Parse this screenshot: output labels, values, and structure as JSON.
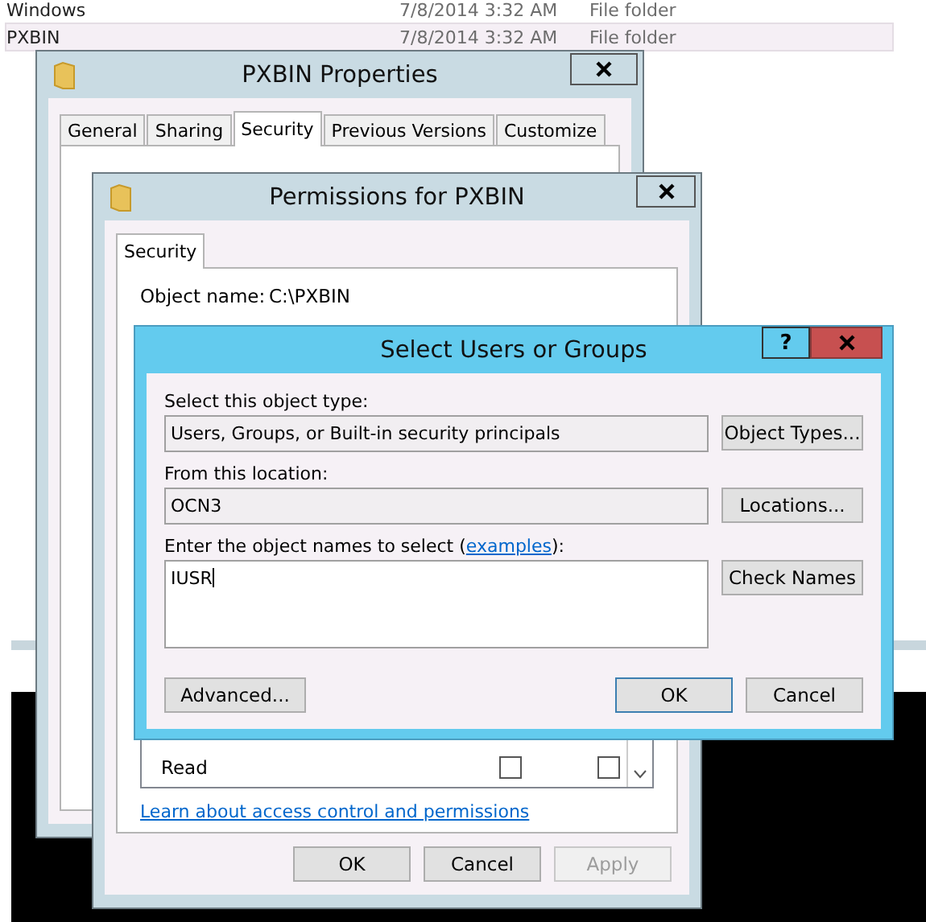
{
  "explorer": {
    "rows": [
      {
        "name": "Windows",
        "date": "7/8/2014 3:32 AM",
        "type": "File folder",
        "selected": false
      },
      {
        "name": "PXBIN",
        "date": "7/8/2014 3:32 AM",
        "type": "File folder",
        "selected": true
      }
    ]
  },
  "properties_window": {
    "title": "PXBIN Properties",
    "tabs": [
      {
        "label": "General",
        "selected": false
      },
      {
        "label": "Sharing",
        "selected": false
      },
      {
        "label": "Security",
        "selected": true
      },
      {
        "label": "Previous Versions",
        "selected": false
      },
      {
        "label": "Customize",
        "selected": false
      }
    ]
  },
  "permissions_window": {
    "title": "Permissions for PXBIN",
    "tabs": [
      {
        "label": "Security",
        "selected": true
      }
    ],
    "object_name_label": "Object name:",
    "object_name": "C:\\PXBIN",
    "permissions": [
      {
        "name": "Read",
        "allow": false,
        "deny": false
      }
    ],
    "link": "Learn about access control and permissions",
    "buttons": [
      {
        "label": "OK",
        "disabled": false
      },
      {
        "label": "Cancel",
        "disabled": false
      },
      {
        "label": "Apply",
        "disabled": true
      }
    ]
  },
  "select_dialog": {
    "title": "Select Users or Groups",
    "help_button": "?",
    "object_type_label": "Select this object type:",
    "object_type": "Users, Groups, or Built-in security principals",
    "object_types_button": "Object Types...",
    "location_label": "From this location:",
    "location": "OCN3",
    "locations_button": "Locations...",
    "names_label_before": "Enter the object names to select (",
    "names_link": "examples",
    "names_label_after": "):",
    "names": "IUSR",
    "check_names_button": "Check Names",
    "advanced_button": "Advanced...",
    "ok_button": "OK",
    "cancel_button": "Cancel"
  }
}
